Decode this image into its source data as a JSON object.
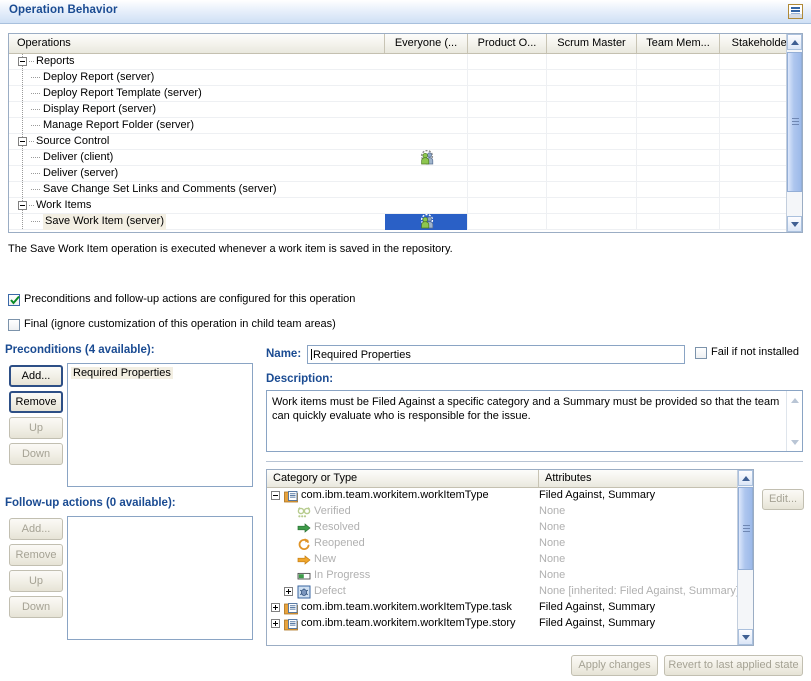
{
  "section": {
    "title": "Operation Behavior",
    "menu_icon": "list-menu-icon"
  },
  "operations_table": {
    "columns": [
      {
        "label": "Operations"
      },
      {
        "label": "Everyone (..."
      },
      {
        "label": "Product O..."
      },
      {
        "label": "Scrum Master"
      },
      {
        "label": "Team Mem..."
      },
      {
        "label": "Stakeholder"
      }
    ],
    "rows": [
      {
        "label": "Reports",
        "level": 0,
        "expandable": true,
        "expanded": true,
        "selected": false,
        "everyone_icon": false
      },
      {
        "label": "Deploy Report (server)",
        "level": 1,
        "expandable": false,
        "selected": false,
        "everyone_icon": false
      },
      {
        "label": "Deploy Report Template (server)",
        "level": 1,
        "expandable": false,
        "selected": false,
        "everyone_icon": false
      },
      {
        "label": "Display Report (server)",
        "level": 1,
        "expandable": false,
        "selected": false,
        "everyone_icon": false
      },
      {
        "label": "Manage Report Folder (server)",
        "level": 1,
        "expandable": false,
        "selected": false,
        "everyone_icon": false
      },
      {
        "label": "Source Control",
        "level": 0,
        "expandable": true,
        "expanded": true,
        "selected": false,
        "everyone_icon": false
      },
      {
        "label": "Deliver (client)",
        "level": 1,
        "expandable": false,
        "selected": false,
        "everyone_icon": true
      },
      {
        "label": "Deliver (server)",
        "level": 1,
        "expandable": false,
        "selected": false,
        "everyone_icon": false
      },
      {
        "label": "Save Change Set Links and Comments (server)",
        "level": 1,
        "expandable": false,
        "selected": false,
        "everyone_icon": false
      },
      {
        "label": "Work Items",
        "level": 0,
        "expandable": true,
        "expanded": true,
        "selected": false,
        "everyone_icon": false
      },
      {
        "label": "Save Work Item (server)",
        "level": 1,
        "expandable": false,
        "selected": true,
        "everyone_icon": true
      }
    ],
    "selection_color": "#2a60c6"
  },
  "info_text": "The Save Work Item operation is executed whenever a work item is saved in the repository.",
  "checkboxes": {
    "preconditions_configured": {
      "label": "Preconditions and follow-up actions are configured for this operation",
      "checked": true
    },
    "final": {
      "label": "Final (ignore customization of this operation in child team areas)",
      "checked": false
    },
    "fail_if_not_installed": {
      "label": "Fail if not installed",
      "checked": false
    }
  },
  "preconditions": {
    "heading": "Preconditions (4 available):",
    "buttons": [
      {
        "label": "Add...",
        "disabled": false
      },
      {
        "label": "Remove",
        "disabled": false
      },
      {
        "label": "Up",
        "disabled": true
      },
      {
        "label": "Down",
        "disabled": true
      }
    ],
    "items": [
      {
        "label": "Required Properties",
        "selected": true
      }
    ]
  },
  "followup": {
    "heading": "Follow-up actions (0 available):",
    "buttons": [
      {
        "label": "Add...",
        "disabled": true
      },
      {
        "label": "Remove",
        "disabled": true
      },
      {
        "label": "Up",
        "disabled": true
      },
      {
        "label": "Down",
        "disabled": true
      }
    ],
    "items": []
  },
  "details": {
    "name_label": "Name:",
    "name_value": "Required Properties",
    "description_label": "Description:",
    "description_value": "Work items must be Filed Against a specific category and a Summary must be provided so that the team can quickly evaluate who is responsible for the issue."
  },
  "category_table": {
    "columns": [
      {
        "label": "Category or Type"
      },
      {
        "label": "Attributes"
      }
    ],
    "rows": [
      {
        "label": "com.ibm.team.workitem.workItemType",
        "attributes": "Filed Against, Summary",
        "level": 0,
        "toggle": "minus",
        "icon": "workitem-type-folder-icon",
        "dim": false
      },
      {
        "label": "Verified",
        "attributes": "None",
        "level": 1,
        "toggle": "none",
        "icon": "verified-glasses-icon",
        "dim": true
      },
      {
        "label": "Resolved",
        "attributes": "None",
        "level": 1,
        "toggle": "none",
        "icon": "resolved-green-arrow-icon",
        "dim": true
      },
      {
        "label": "Reopened",
        "attributes": "None",
        "level": 1,
        "toggle": "none",
        "icon": "reopened-orange-circle-icon",
        "dim": true
      },
      {
        "label": "New",
        "attributes": "None",
        "level": 1,
        "toggle": "none",
        "icon": "new-orange-arrow-icon",
        "dim": true
      },
      {
        "label": "In Progress",
        "attributes": "None",
        "level": 1,
        "toggle": "none",
        "icon": "in-progress-bar-icon",
        "dim": true
      },
      {
        "label": "Defect",
        "attributes": "None [inherited: Filed Against, Summary]",
        "level": 1,
        "toggle": "plus",
        "icon": "defect-bug-icon",
        "dim": true
      },
      {
        "label": "com.ibm.team.workitem.workItemType.task",
        "attributes": "Filed Against, Summary",
        "level": 0,
        "toggle": "plus",
        "icon": "workitem-type-folder-icon",
        "dim": false
      },
      {
        "label": "com.ibm.team.workitem.workItemType.story",
        "attributes": "Filed Against, Summary",
        "level": 0,
        "toggle": "plus",
        "icon": "workitem-type-folder-icon",
        "dim": false
      }
    ],
    "edit_button": {
      "label": "Edit...",
      "disabled": true
    }
  },
  "footer": {
    "apply_label": "Apply changes",
    "revert_label": "Revert to last applied state",
    "apply_disabled": true,
    "revert_disabled": true
  },
  "colors": {
    "heading_blue": "#1a4b92",
    "selection_blue": "#2a60c6",
    "selection_beige": "#f3efe3"
  }
}
